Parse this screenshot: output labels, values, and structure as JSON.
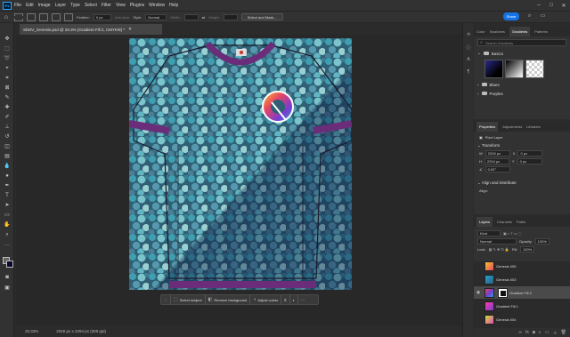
{
  "menu": [
    "File",
    "Edit",
    "Image",
    "Layer",
    "Type",
    "Select",
    "Filter",
    "View",
    "Plugins",
    "Window",
    "Help"
  ],
  "options": {
    "feather_label": "Feather:",
    "feather_value": "0 px",
    "antialias": "Anti-alias",
    "style_label": "Style:",
    "style_value": "Normal",
    "width_label": "Width:",
    "height_label": "Height:",
    "select_mask": "Select and Mask..."
  },
  "share_label": "Share",
  "document": {
    "tab_title": "ShirtV_Genesis.psd @ 33.3% (Gradient Fill 2, CMYK/8) *"
  },
  "taskbar": {
    "select_subject": "Select subject",
    "remove_background": "Remove background",
    "adjust_colors": "Adjust colors"
  },
  "status": {
    "zoom": "33.33%",
    "size": "2026 px x 2294 px (300 ppi)"
  },
  "gradients_panel": {
    "tabs": [
      "Color",
      "Swatches",
      "Gradients",
      "Patterns"
    ],
    "active_tab": "Gradients",
    "search_placeholder": "Search Gradients",
    "groups": [
      "Basics",
      "Blues",
      "Purples"
    ]
  },
  "properties_panel": {
    "tabs": [
      "Properties",
      "Adjustments",
      "Libraries"
    ],
    "layer_type": "Pixel Layer",
    "transform_title": "Transform",
    "w": "2026 px",
    "h": "2294 px",
    "x": "0 px",
    "y": "0 px",
    "angle": "0.00°",
    "align_title": "Align and Distribute",
    "align_label": "Align:"
  },
  "layers_panel": {
    "tabs": [
      "Layers",
      "Channels",
      "Paths"
    ],
    "kind": "Kind",
    "blend": "Normal",
    "opacity_label": "Opacity:",
    "opacity": "100%",
    "lock_label": "Lock:",
    "fill_label": "Fill:",
    "fill": "100%",
    "layers": [
      "Genesis 005",
      "Genesis 003",
      "Gradient Fill 2",
      "Gradient Fill 1",
      "Genesis 004"
    ],
    "active_layer": "Gradient Fill 2"
  },
  "colors": {
    "accent": "#1473e6",
    "collar": "#6b2d7a",
    "fabric": "#2e6e86"
  }
}
